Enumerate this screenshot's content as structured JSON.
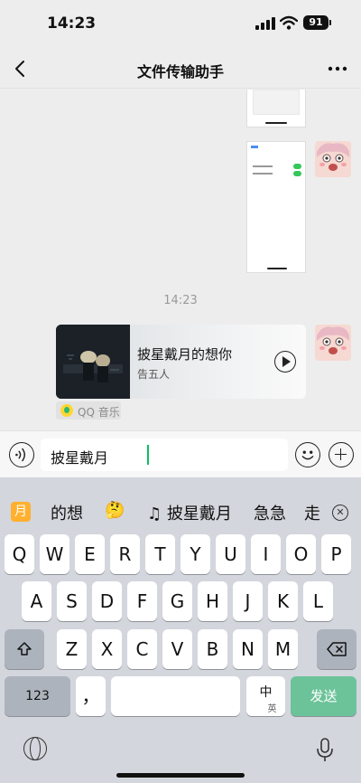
{
  "status": {
    "time": "14:23",
    "battery": "91"
  },
  "nav": {
    "title": "文件传输助手"
  },
  "chat": {
    "timestamp": "14:23",
    "music": {
      "song": "披星戴月的想你",
      "artist": "告五人",
      "source": "QQ 音乐"
    }
  },
  "input": {
    "value": "披星戴月"
  },
  "candidates": [
    {
      "text": "月"
    },
    {
      "text": "的想"
    },
    {
      "text": "🤔"
    },
    {
      "text": "♫ 披星戴月"
    },
    {
      "text": "急急"
    },
    {
      "text": "走"
    }
  ],
  "keyboard": {
    "row1": [
      "Q",
      "W",
      "E",
      "R",
      "T",
      "Y",
      "U",
      "I",
      "O",
      "P"
    ],
    "row2": [
      "A",
      "S",
      "D",
      "F",
      "G",
      "H",
      "J",
      "K",
      "L"
    ],
    "row3": [
      "Z",
      "X",
      "C",
      "V",
      "B",
      "N",
      "M"
    ],
    "numbers": "123",
    "comma": "，",
    "lang_main": "中",
    "lang_alt": "英",
    "send": "发送"
  },
  "colors": {
    "accent": "#07c160",
    "send_key": "#6cc39a",
    "chat_bg": "#ededed",
    "keyboard_bg": "#d3d6dc"
  }
}
